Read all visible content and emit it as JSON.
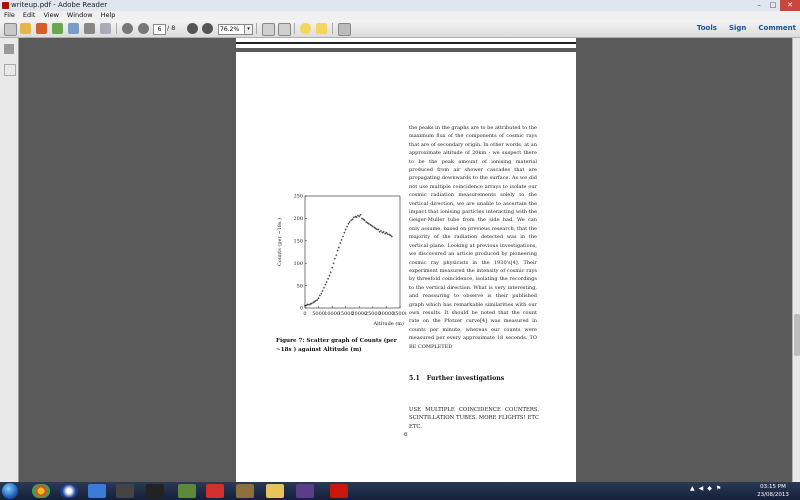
{
  "window": {
    "title": "writeup.pdf - Adobe Reader",
    "controls": [
      "–",
      "□",
      "✕"
    ]
  },
  "menu": [
    "File",
    "Edit",
    "View",
    "Window",
    "Help"
  ],
  "toolbar": {
    "current_page": "6",
    "page_total": "/ 8",
    "zoom": "76.2%",
    "links": [
      "Tools",
      "Sign",
      "Comment"
    ]
  },
  "document": {
    "right_column": "the peaks in the graphs are to be attributed to the maximum flux of the components of cosmic rays that are of secondary origin. In other words, at an approximate altitude of 20km - we suspect there to be the peak amount of ionising material produced from air shower cascades that are propagating downwards to the surface. As we did not use multiple coincidence arrays to isolate our cosmic radiation measurements solely to the vertical direction, we are unable to ascertain the impact that ionising particles interacting with the Geiger-Muller tube from the side had. We can only assume, based on previous research, that the majority of the radiation detected was in the vertical plane. Looking at previous investigations, we discovered an article produced by pioneering cosmic ray physicists in the 1930's[4]. Their experiment measured the intensity of cosmic rays by threefold coincidence, isolating the recordings to the vertical direction. What is very interesting, and reassuring to observe is their published graph which has remarkable similarities with our own results. It should be noted that the count rate on the Pfotzer curve[4] was measured in counts per minute, whereas our counts were measured per every approximate 18 seconds. TO BE COMPLETED",
    "section_number": "5.1",
    "section_title": "Further investigations",
    "section_text": "USE MULTIPLE COINCIDENCE COUNTERS. SCINTILLATION TUBES. MORE FLIGHTS! ETC ETC.",
    "page_number": "6",
    "caption": "Figure 7: Scatter graph of Counts (per ~18s ) against Altitude (m)"
  },
  "chart_data": {
    "type": "scatter",
    "title": "",
    "xlabel": "Altitude (m)",
    "ylabel": "Counts (per ~18s )",
    "xlim": [
      0,
      35000
    ],
    "ylim": [
      0,
      250
    ],
    "x_ticks": [
      "0",
      "5000",
      "10000",
      "15000",
      "20000",
      "25000",
      "30000",
      "35000"
    ],
    "y_ticks": [
      "0",
      "50",
      "100",
      "150",
      "200",
      "250"
    ],
    "grid": false,
    "series": [
      {
        "x": [
          0,
          500,
          1000,
          1500,
          2000,
          2500,
          3000,
          3500,
          4000,
          4500,
          5000,
          5500,
          6000,
          6500,
          7000,
          7500,
          8000,
          8500,
          9000,
          9500,
          10000,
          10500,
          11000,
          11500,
          12000,
          12500,
          13000,
          13500,
          14000,
          14500,
          15000,
          15500,
          16000,
          16500,
          17000,
          17500,
          18000,
          18500,
          19000,
          19500,
          20000,
          20500,
          21000,
          21500,
          22000,
          22500,
          23000,
          23500,
          24000,
          24500,
          25000,
          25500,
          26000,
          26500,
          27000,
          27500,
          28000,
          28500,
          29000,
          29500,
          30000,
          30500,
          31000,
          31500,
          32000
        ],
        "y": [
          5,
          6,
          8,
          7,
          9,
          10,
          12,
          14,
          16,
          18,
          22,
          28,
          32,
          38,
          45,
          52,
          58,
          65,
          72,
          80,
          90,
          100,
          110,
          118,
          128,
          135,
          145,
          152,
          160,
          168,
          175,
          182,
          188,
          192,
          196,
          198,
          202,
          204,
          203,
          206,
          205,
          208,
          200,
          198,
          196,
          192,
          190,
          188,
          186,
          184,
          182,
          180,
          178,
          176,
          175,
          170,
          172,
          168,
          170,
          166,
          168,
          165,
          164,
          162,
          160
        ]
      }
    ]
  },
  "taskbar": {
    "time": "03:15 PM",
    "date": "23/08/2013"
  }
}
